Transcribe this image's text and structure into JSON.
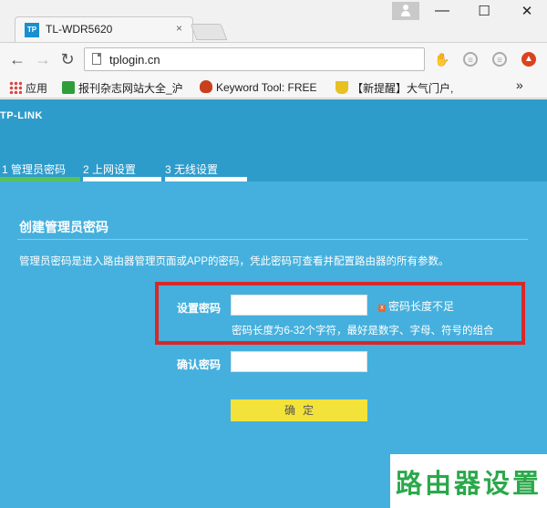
{
  "browser": {
    "tab_title": "TL-WDR5620",
    "tab_favicon_text": "TP",
    "tab_close": "×",
    "window": {
      "minimize": "—",
      "maximize": "☐",
      "close": "✕"
    },
    "nav": {
      "back": "←",
      "forward": "→",
      "reload": "↻"
    },
    "url": "tplogin.cn",
    "bookmarks": [
      {
        "label": "应用",
        "icon": "apps-grid-icon"
      },
      {
        "label": "报刊杂志网站大全_沪",
        "icon": "bookmark-green-icon"
      },
      {
        "label": "Keyword Tool: FREE",
        "icon": "bookmark-flame-icon"
      },
      {
        "label": "【新提醒】大气门户,",
        "icon": "bookmark-trophy-icon"
      }
    ],
    "bookmarks_more": "»"
  },
  "page": {
    "logo": "TP-LINK",
    "steps": [
      {
        "label": "1 管理员密码",
        "active": true
      },
      {
        "label": "2 上网设置",
        "active": false
      },
      {
        "label": "3 无线设置",
        "active": false
      }
    ],
    "section_title": "创建管理员密码",
    "description": "管理员密码是进入路由器管理页面或APP的密码，凭此密码可查看并配置路由器的所有参数。",
    "set_password_label": "设置密码",
    "set_password_value": "",
    "error_icon": "x",
    "error_text": "密码长度不足",
    "hint": "密码长度为6-32个字符，最好是数字、字母、符号的组合",
    "confirm_password_label": "确认密码",
    "confirm_password_value": "",
    "confirm_button": "确定"
  },
  "watermark": "路由器设置",
  "colors": {
    "page_bg": "#45b0dd",
    "header_bg": "#2e9ccb",
    "active_step": "#58c25b",
    "button": "#f2e23a",
    "highlight_box": "#d8282a",
    "watermark": "#2ba84a"
  }
}
